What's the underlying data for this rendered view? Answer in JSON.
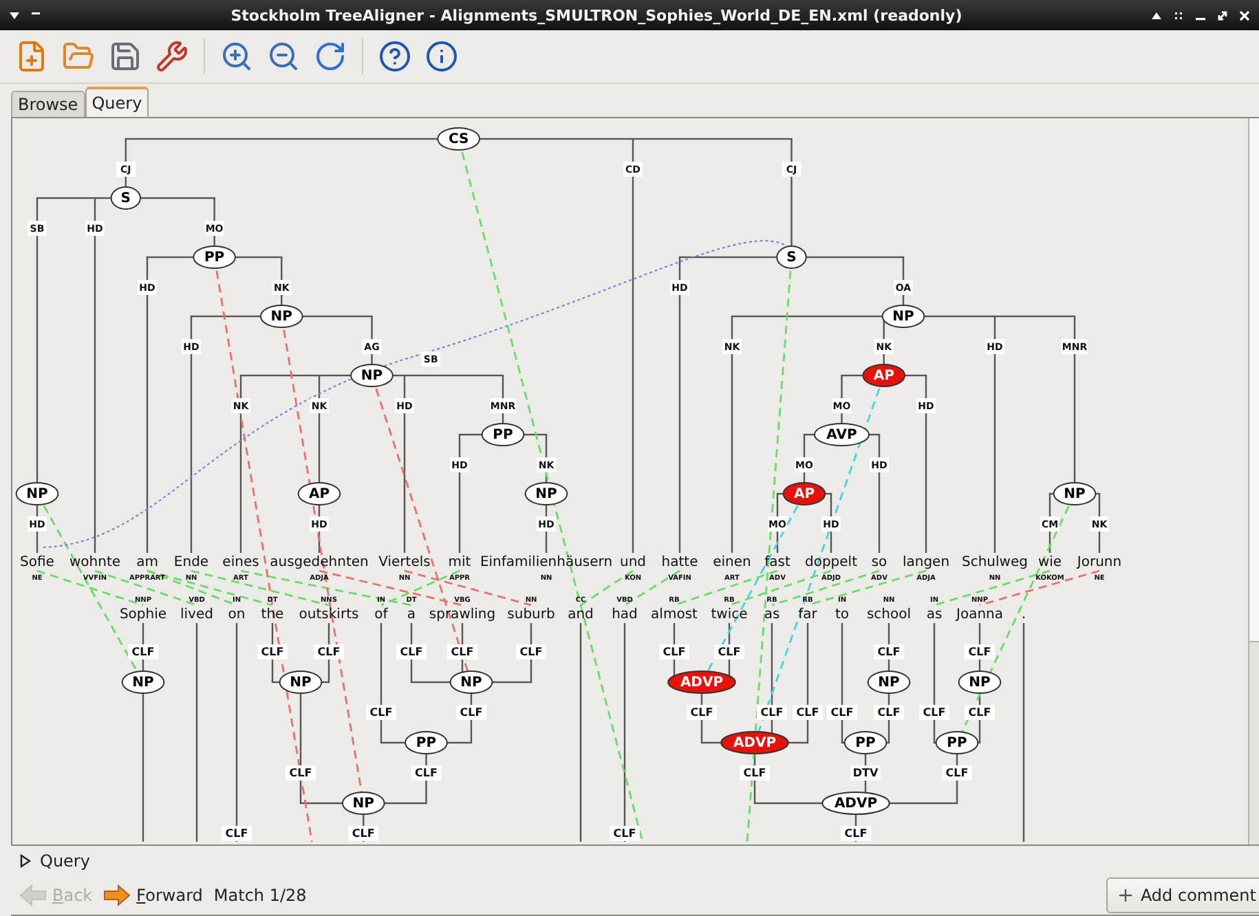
{
  "window": {
    "title": "Stockholm TreeAligner - Alignments_SMULTRON_Sophies_World_DE_EN.xml (readonly)"
  },
  "tabs": [
    {
      "label": "Browse",
      "selected": false
    },
    {
      "label": "Query",
      "selected": true
    }
  ],
  "source_tree": {
    "label": "CS",
    "matched": false,
    "children": [
      {
        "edge": "CJ",
        "label": "S",
        "matched": false,
        "children": [
          {
            "edge": "SB",
            "label": "NP",
            "matched": false,
            "children": [
              {
                "edge": "HD",
                "word": "Sofie",
                "tag": "NE"
              }
            ]
          },
          {
            "edge": "HD",
            "word": "wohnte",
            "tag": "VVFIN"
          },
          {
            "edge": "MO",
            "label": "PP",
            "matched": false,
            "children": [
              {
                "edge": "HD",
                "word": "am",
                "tag": "APPRART"
              },
              {
                "edge": "NK",
                "label": "NP",
                "matched": false,
                "children": [
                  {
                    "edge": "HD",
                    "word": "Ende",
                    "tag": "NN"
                  },
                  {
                    "edge": "AG",
                    "label": "NP",
                    "matched": false,
                    "children": [
                      {
                        "edge": "NK",
                        "word": "eines",
                        "tag": "ART"
                      },
                      {
                        "edge": "NK",
                        "label": "AP",
                        "matched": false,
                        "children": [
                          {
                            "edge": "HD",
                            "word": "ausgedehnten",
                            "tag": "ADJA"
                          }
                        ]
                      },
                      {
                        "edge": "HD",
                        "word": "Viertels",
                        "tag": "NN"
                      },
                      {
                        "edge": "MNR",
                        "label": "PP",
                        "matched": false,
                        "children": [
                          {
                            "edge": "HD",
                            "word": "mit",
                            "tag": "APPR"
                          },
                          {
                            "edge": "NK",
                            "label": "NP",
                            "matched": false,
                            "children": [
                              {
                                "edge": "HD",
                                "word": "Einfamilienhäusern",
                                "tag": "NN"
                              }
                            ]
                          }
                        ]
                      }
                    ]
                  }
                ]
              }
            ]
          }
        ]
      },
      {
        "edge": "CD",
        "word": "und",
        "tag": "KON"
      },
      {
        "edge": "CJ",
        "label": "S",
        "matched": false,
        "children": [
          {
            "edge": "HD",
            "word": "hatte",
            "tag": "VAFIN"
          },
          {
            "edge": "OA",
            "label": "NP",
            "matched": false,
            "children": [
              {
                "edge": "NK",
                "word": "einen",
                "tag": "ART"
              },
              {
                "edge": "NK",
                "label": "AP",
                "matched": true,
                "children": [
                  {
                    "edge": "MO",
                    "label": "AVP",
                    "matched": false,
                    "children": [
                      {
                        "edge": "MO",
                        "label": "AP",
                        "matched": true,
                        "children": [
                          {
                            "edge": "MO",
                            "word": "fast",
                            "tag": "ADV"
                          },
                          {
                            "edge": "HD",
                            "word": "doppelt",
                            "tag": "ADJD"
                          }
                        ]
                      },
                      {
                        "edge": "HD",
                        "word": "so",
                        "tag": "ADV"
                      }
                    ]
                  },
                  {
                    "edge": "HD",
                    "word": "langen",
                    "tag": "ADJA"
                  }
                ]
              },
              {
                "edge": "HD",
                "word": "Schulweg",
                "tag": "NN"
              },
              {
                "edge": "MNR",
                "label": "NP",
                "matched": false,
                "children": [
                  {
                    "edge": "CM",
                    "word": "wie",
                    "tag": "KOKOM"
                  },
                  {
                    "edge": "NK",
                    "word": "Jorunn",
                    "tag": "NE"
                  }
                ]
              }
            ]
          }
        ]
      }
    ]
  },
  "target_tree": {
    "children": [
      {
        "label": "NP",
        "matched": false,
        "children": [
          {
            "edge": "CLF",
            "word": "Sophie",
            "tag": "NNP"
          }
        ]
      },
      {
        "word": "lived",
        "tag": "VBD"
      },
      {
        "edge": "CLF",
        "word": "on",
        "tag": "IN"
      },
      {
        "edge": "CLF",
        "label": "NP",
        "matched": false,
        "children": [
          {
            "edge": "CLF",
            "label": "NP",
            "matched": false,
            "children": [
              {
                "edge": "CLF",
                "word": "the",
                "tag": "DT"
              },
              {
                "edge": "CLF",
                "word": "outskirts",
                "tag": "NNS"
              }
            ]
          },
          {
            "edge": "CLF",
            "label": "PP",
            "matched": false,
            "children": [
              {
                "edge": "CLF",
                "word": "of",
                "tag": "IN"
              },
              {
                "edge": "CLF",
                "label": "NP",
                "matched": false,
                "children": [
                  {
                    "edge": "CLF",
                    "word": "a",
                    "tag": "DT"
                  },
                  {
                    "edge": "CLF",
                    "word": "sprawling",
                    "tag": "VBG"
                  },
                  {
                    "edge": "CLF",
                    "word": "suburb",
                    "tag": "NN"
                  }
                ]
              }
            ]
          }
        ]
      },
      {
        "word": "and",
        "tag": "CC"
      },
      {
        "edge": "CLF",
        "word": "had",
        "tag": "VBD"
      },
      {
        "edge": "CLF",
        "label": "ADVP",
        "matched": false,
        "children": [
          {
            "edge": "CLF",
            "label": "ADVP",
            "matched": true,
            "children": [
              {
                "edge": "CLF",
                "label": "ADVP",
                "matched": true,
                "children": [
                  {
                    "edge": "CLF",
                    "word": "almost",
                    "tag": "RB"
                  },
                  {
                    "edge": "CLF",
                    "word": "twice",
                    "tag": "RB"
                  }
                ]
              },
              {
                "edge": "CLF",
                "word": "as",
                "tag": "RB"
              },
              {
                "edge": "CLF",
                "word": "far",
                "tag": "RB"
              }
            ]
          },
          {
            "edge": "DTV",
            "label": "PP",
            "matched": false,
            "children": [
              {
                "edge": "CLF",
                "word": "to",
                "tag": "IN"
              },
              {
                "edge": "CLF",
                "label": "NP",
                "matched": false,
                "children": [
                  {
                    "edge": "CLF",
                    "word": "school",
                    "tag": "NN"
                  }
                ]
              }
            ]
          },
          {
            "edge": "CLF",
            "label": "PP",
            "matched": false,
            "children": [
              {
                "edge": "CLF",
                "word": "as",
                "tag": "IN"
              },
              {
                "edge": "CLF",
                "label": "NP",
                "matched": false,
                "children": [
                  {
                    "edge": "CLF",
                    "word": "Joanna",
                    "tag": "NNP"
                  }
                ]
              }
            ]
          }
        ]
      },
      {
        "word": "."
      }
    ]
  },
  "secondary_edges": [
    {
      "label": "SB"
    }
  ],
  "alignments": [
    {
      "color": "#66dd66"
    },
    {
      "color": "#66dd66"
    },
    {
      "color": "#66dd66"
    },
    {
      "color": "#66dd66"
    },
    {
      "color": "#66dd66"
    },
    {
      "color": "#66dd66"
    },
    {
      "color": "#66dd66"
    },
    {
      "color": "#66dd66"
    },
    {
      "color": "#66dd66"
    },
    {
      "color": "#66dd66"
    },
    {
      "color": "#66dd66"
    },
    {
      "color": "#66dd66"
    },
    {
      "color": "#66dd66"
    },
    {
      "color": "#66dd66"
    },
    {
      "color": "#66dd66"
    },
    {
      "color": "#66dd66"
    },
    {
      "color": "#66dd66"
    },
    {
      "color": "#66dd66"
    },
    {
      "color": "#e87070"
    },
    {
      "color": "#e87070"
    },
    {
      "color": "#e87070"
    },
    {
      "color": "#e87070"
    },
    {
      "color": "#e87070"
    },
    {
      "color": "#e87070"
    },
    {
      "color": "#44d4e4"
    },
    {
      "color": "#44d4e4"
    }
  ],
  "query_expander": {
    "label": "Query",
    "expanded": false
  },
  "navigation": {
    "back": {
      "label": "Back",
      "disabled": true
    },
    "forward": {
      "label": "Forward",
      "disabled": false
    },
    "match": "Match 1/28"
  },
  "add_comment": "Add comment"
}
